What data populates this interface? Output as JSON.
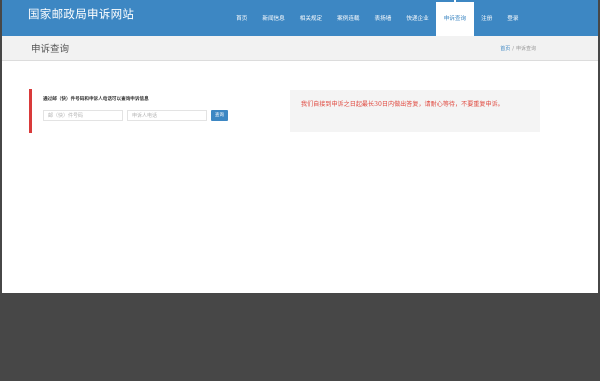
{
  "header": {
    "site_title": "国家邮政局申诉网站",
    "nav": [
      {
        "label": "首页",
        "active": false
      },
      {
        "label": "新闻信息",
        "active": false
      },
      {
        "label": "相关规定",
        "active": false
      },
      {
        "label": "案例连载",
        "active": false
      },
      {
        "label": "表扬墙",
        "active": false
      },
      {
        "label": "快递企业",
        "active": false
      },
      {
        "label": "申诉查询",
        "active": true
      },
      {
        "label": "注册",
        "active": false
      },
      {
        "label": "登录",
        "active": false
      }
    ]
  },
  "crumbs": {
    "page_title": "申诉查询",
    "home": "首页",
    "separator": "/",
    "current": "申诉查询"
  },
  "query": {
    "hint": "通过邮（快）件号码和申诉人电话可以查询申诉信息",
    "mail_number": {
      "value": "",
      "placeholder": "邮（快）件号码"
    },
    "phone": {
      "value": "",
      "placeholder": "申诉人电话"
    },
    "button": "查询"
  },
  "notice": {
    "text": "我们自接到申诉之日起最长30日内做出答复，请耐心等待，不要重复申诉。"
  },
  "colors": {
    "header_blue": "#3d87c3",
    "accent_red": "#d93a3a",
    "notice_text": "#e0483e",
    "backdrop": "#474747"
  }
}
